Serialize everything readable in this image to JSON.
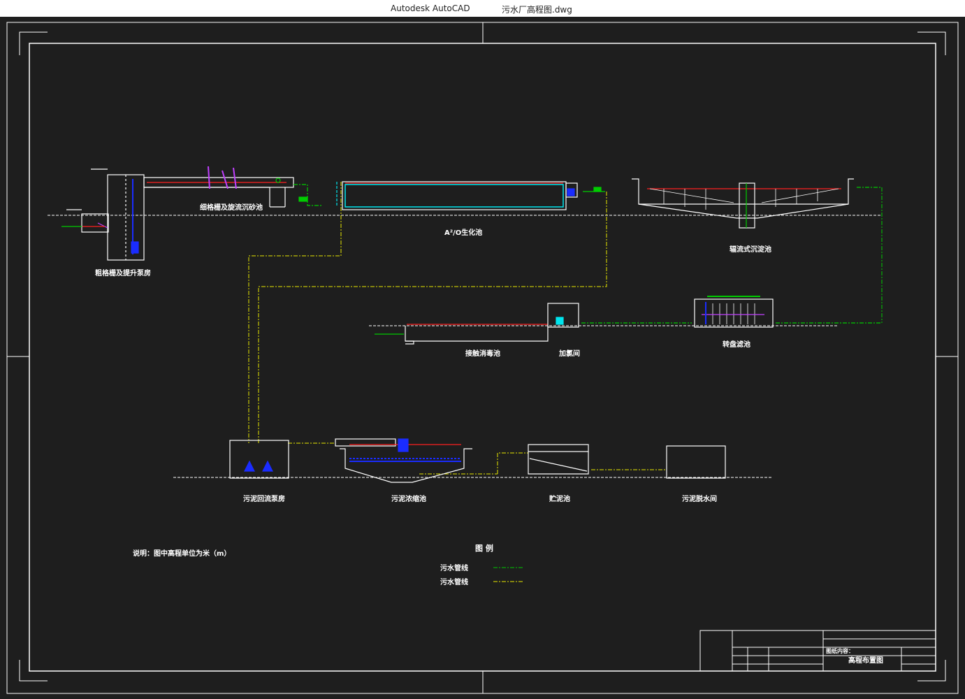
{
  "window": {
    "app_name": "Autodesk AutoCAD",
    "file_name": "污水厂高程图.dwg"
  },
  "units": [
    {
      "id": "coarse",
      "label": "粗格栅及提升泵房"
    },
    {
      "id": "fine",
      "label": "细格栅及旋流沉砂池"
    },
    {
      "id": "a2o",
      "label": "A²/O生化池"
    },
    {
      "id": "clarifier",
      "label": "辐流式沉淀池"
    },
    {
      "id": "contact",
      "label": "接触消毒池"
    },
    {
      "id": "dosing",
      "label": "加氯间"
    },
    {
      "id": "filter",
      "label": "转盘滤池"
    },
    {
      "id": "sludge_return",
      "label": "污泥回流泵房"
    },
    {
      "id": "thickener",
      "label": "污泥浓缩池"
    },
    {
      "id": "storage",
      "label": "贮泥池"
    },
    {
      "id": "dewater",
      "label": "污泥脱水间"
    }
  ],
  "note": "说明：图中高程单位为米（m）",
  "legend": {
    "title": "图 例",
    "items": [
      {
        "label": "污水管线",
        "color": "#00cc00"
      },
      {
        "label": "污水管线",
        "color": "#e8e800"
      }
    ]
  },
  "title_block": {
    "design_content_label": "图纸内容：",
    "drawing_title": "高程布置图"
  },
  "colors": {
    "canvas": "#1e1e1e",
    "line_white": "#ffffff",
    "water_red": "#ff2020",
    "pipe_green": "#00cc00",
    "pipe_yellow": "#e8e800",
    "cyan": "#00e5ee",
    "blue": "#1a2cff",
    "magenta": "#c040ff"
  }
}
